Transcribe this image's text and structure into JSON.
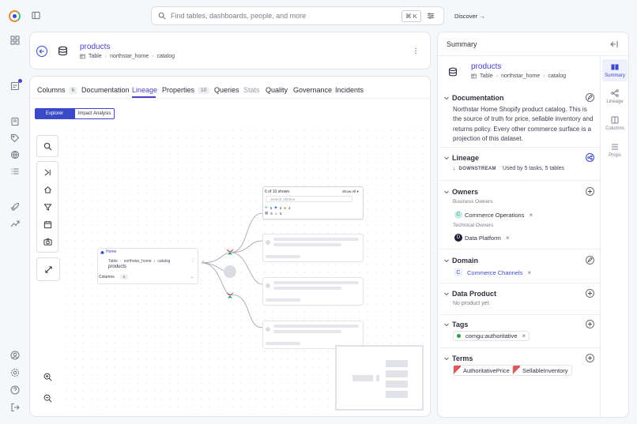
{
  "search": {
    "placeholder": "Find tables, dashboards, people, and more",
    "shortcut": "⌘ K"
  },
  "topbar": {
    "discover_label": "Discover →"
  },
  "asset": {
    "name": "products",
    "type": "Table",
    "breadcrumb": [
      "northstar_home",
      "catalog"
    ]
  },
  "tabs": [
    {
      "label": "Columns",
      "count": "6"
    },
    {
      "label": "Documentation"
    },
    {
      "label": "Lineage"
    },
    {
      "label": "Properties",
      "count": "10"
    },
    {
      "label": "Queries"
    },
    {
      "label": "Stats"
    },
    {
      "label": "Quality"
    },
    {
      "label": "Governance"
    },
    {
      "label": "Incidents"
    }
  ],
  "lineage": {
    "modes": [
      "Explorer",
      "Impact Analysis"
    ],
    "node": {
      "home_label": "Home",
      "type": "Table",
      "path": [
        "northstar_home",
        "catalog"
      ],
      "name": "products",
      "columns_label": "Columns",
      "columns_count": "6"
    },
    "children_panel": {
      "shown": "6 of 10 shown",
      "show_all": "Show All",
      "search_placeholder": "Search children",
      "stats_row1": [
        "5",
        "3",
        "2"
      ],
      "stats_row2": [
        "5",
        "5"
      ]
    }
  },
  "summary": {
    "header": "Summary",
    "name": "products",
    "type": "Table",
    "breadcrumb": [
      "northstar_home",
      "catalog"
    ],
    "documentation": {
      "title": "Documentation",
      "text": "Northstar Home Shopify product catalog. This is the source of truth for price, sellable inventory and returns policy. Every other commerce surface is a projection of this dataset."
    },
    "lineage": {
      "title": "Lineage",
      "direction": "DOWNSTREAM",
      "used_by": "Used by 5 tasks, 5 tables"
    },
    "owners": {
      "title": "Owners",
      "business_label": "Business Owners",
      "business_owner": "Commerce Operations",
      "technical_label": "Technical Owners",
      "technical_owner": "Data Platform"
    },
    "domain": {
      "title": "Domain",
      "value": "Commerce Channels"
    },
    "data_product": {
      "title": "Data Product",
      "value": "No product yet."
    },
    "tags": {
      "title": "Tags",
      "value": "comgu:authoritative"
    },
    "terms": {
      "title": "Terms",
      "values": [
        "AuthoritativePrice",
        "SellableInventory"
      ]
    }
  },
  "right_tabs": [
    "Summary",
    "Lineage",
    "Columns",
    "Props"
  ],
  "colors": {
    "accent": "#4b3fc4",
    "lineage_ring": "#3b4ac8"
  }
}
